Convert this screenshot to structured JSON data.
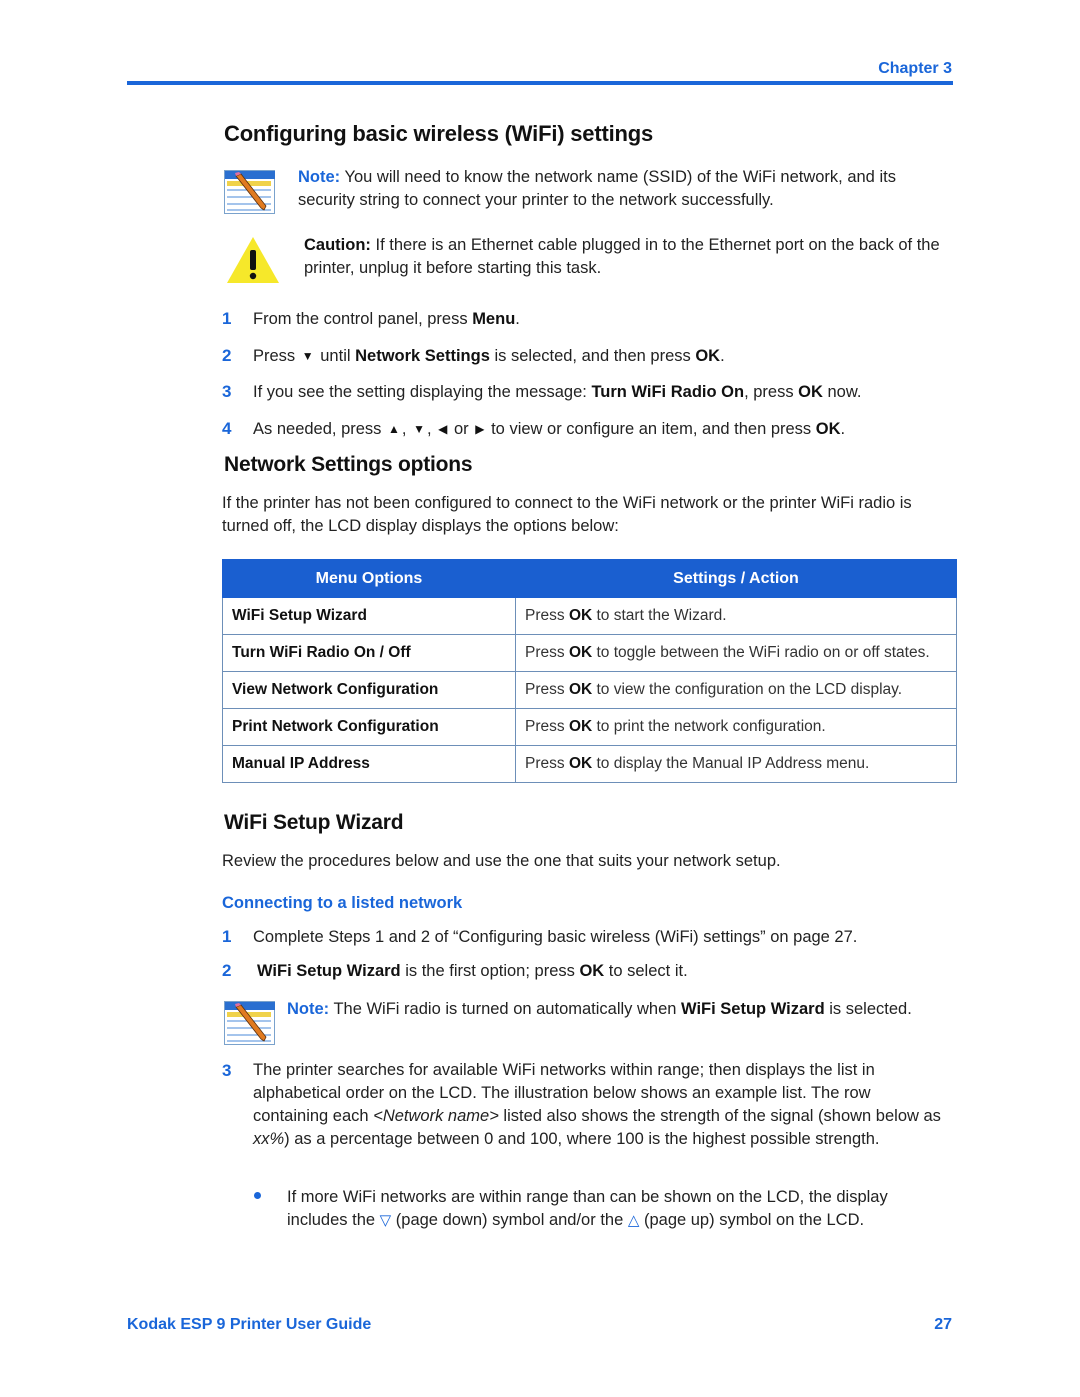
{
  "header": {
    "chapter": "Chapter 3"
  },
  "section1": {
    "title": "Configuring basic wireless (WiFi) settings",
    "note": {
      "label": "Note:",
      "text": "You will need to know the network name (SSID) of the WiFi network, and its security string to connect your printer to the network successfully.",
      "icon": "note-pencil-icon"
    },
    "caution": {
      "label": "Caution:",
      "text": "If there is an Ethernet cable plugged in to the Ethernet port on the back of the printer, unplug it before starting this task.",
      "icon": "warning-icon"
    },
    "steps": [
      {
        "num": "1",
        "pre": "From the control panel, press ",
        "bold": "Menu",
        "post": "."
      },
      {
        "num": "2",
        "pre": "Press",
        "arrow": "▼",
        "mid": " until ",
        "bold": "Network Settings",
        "post": " is selected, and then press ",
        "bold2": "OK",
        "post2": "."
      },
      {
        "num": "3",
        "pre": "If you see the setting displaying the message: ",
        "bold": "Turn WiFi Radio On",
        "post": ", press ",
        "bold2": "OK",
        "post2": " now."
      },
      {
        "num": "4",
        "pre": "As needed, press",
        "arrows": [
          "▲",
          "▼",
          "◀",
          "▶"
        ],
        "sep1": ",",
        "sep2": ",",
        "or": "or",
        "post": "to view or configure an item, and then press ",
        "bold": "OK",
        "post2": "."
      }
    ]
  },
  "section2": {
    "title": "Network Settings options",
    "intro": "If the printer has not been configured to connect to the WiFi network or  the printer WiFi radio is turned off, the LCD display displays the options below:",
    "table": {
      "headers": [
        "Menu Options",
        "Settings / Action"
      ],
      "rows": [
        {
          "option": "WiFi Setup Wizard",
          "pre": "Press ",
          "bold": "OK",
          "post": " to start the Wizard."
        },
        {
          "option": "Turn WiFi Radio On / Off",
          "pre": "Press ",
          "bold": "OK",
          "post": " to toggle between the WiFi radio on or off states."
        },
        {
          "option": "View Network Configuration",
          "pre": "Press ",
          "bold": "OK",
          "post": " to view the configuration on the LCD display."
        },
        {
          "option": "Print Network Configuration",
          "pre": "Press ",
          "bold": "OK",
          "post": " to print the network configuration."
        },
        {
          "option": "Manual IP Address",
          "pre": "Press ",
          "bold": "OK",
          "post": " to display the Manual IP Address  menu."
        }
      ]
    }
  },
  "section3": {
    "title": "WiFi Setup Wizard",
    "intro": "Review the procedures below and use the one that suits your network setup.",
    "subhead": "Connecting to a listed network",
    "steps": [
      {
        "num": "1",
        "text": "Complete Steps 1 and 2 of “Configuring basic wireless (WiFi) settings” on page 27."
      },
      {
        "num": "2",
        "bold": "WiFi Setup Wizard",
        "post": " is the first option; press ",
        "bold2": "OK",
        "post2": " to select it."
      }
    ],
    "note": {
      "label": "Note:",
      "pre": "The WiFi radio is turned on automatically when ",
      "bold": "WiFi Setup Wizard",
      "post": " is selected."
    },
    "step3": {
      "num": "3",
      "t1": "The printer searches for available WiFi networks within range; then displays the list in alphabetical order on the LCD. The illustration below shows an example list. The row containing each ",
      "em1": "<Network name>",
      "t2": " listed also shows the strength of the signal (shown below as ",
      "em2": "xx%",
      "t3": ") as a percentage between 0 and 100, where 100 is the highest possible strength."
    },
    "bullet": {
      "t1": "If more WiFi networks are within range than can be shown on the LCD, the display includes the ",
      "sym1": "▽",
      "t2": " (page down) symbol and/or the ",
      "sym2": "△",
      "t3": " (page up) symbol on the LCD."
    }
  },
  "footer": {
    "title": "Kodak ESP 9 Printer User Guide",
    "page": "27"
  }
}
